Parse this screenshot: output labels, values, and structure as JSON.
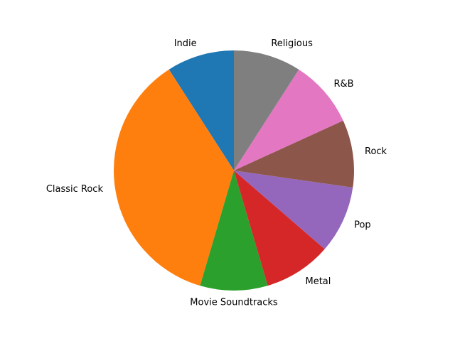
{
  "chart_data": {
    "type": "pie",
    "start_angle_deg": 90,
    "direction": "counterclockwise",
    "slices": [
      {
        "label": "Indie",
        "value": 1,
        "color": "#1f77b4"
      },
      {
        "label": "Classic Rock",
        "value": 4,
        "color": "#ff7f0e"
      },
      {
        "label": "Movie Soundtracks",
        "value": 1,
        "color": "#2ca02c"
      },
      {
        "label": "Metal",
        "value": 1,
        "color": "#d62728"
      },
      {
        "label": "Pop",
        "value": 1,
        "color": "#9467bd"
      },
      {
        "label": "Rock",
        "value": 1,
        "color": "#8c564b"
      },
      {
        "label": "R&B",
        "value": 1,
        "color": "#e377c2"
      },
      {
        "label": "Religious",
        "value": 1,
        "color": "#7f7f7f"
      }
    ]
  }
}
